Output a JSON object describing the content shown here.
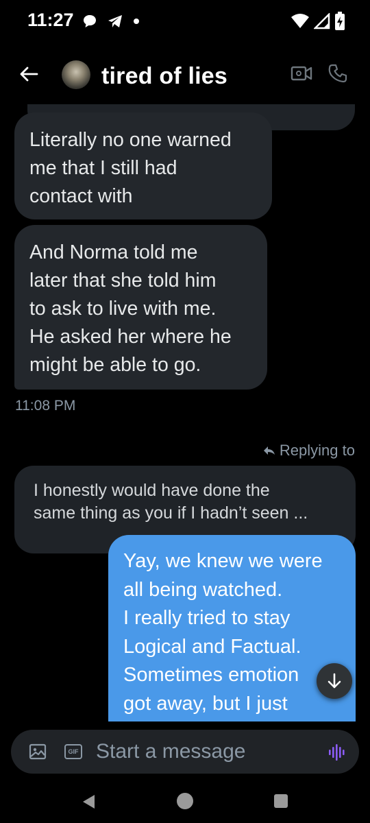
{
  "status_bar": {
    "time": "11:27"
  },
  "header": {
    "title": "tired of lies"
  },
  "messages": {
    "incoming": [
      {
        "lines": [
          "Literally no one warned",
          "me that I still had",
          "contact with"
        ]
      },
      {
        "lines": [
          "And Norma told me",
          "later that she told him",
          "to ask to live with me.",
          "He asked her where he",
          "might be able to go."
        ]
      }
    ],
    "timestamp": "11:08 PM",
    "replying_label": "Replying to",
    "quote_lines": [
      "I honestly would have done the",
      "same thing as you if I hadn’t seen ..."
    ],
    "outgoing_lines": [
      "Yay, we knew we were",
      "all being watched.",
      "I really tried to stay",
      "Logical and Factual.",
      "Sometimes emotion",
      "got away, but I just"
    ]
  },
  "composer": {
    "placeholder": "Start a message",
    "gif_label": "GIF"
  },
  "colors": {
    "outgoing_bubble": "#4a99e9",
    "incoming_bubble": "#23272c",
    "accent_voice": "#8b5cf6"
  }
}
